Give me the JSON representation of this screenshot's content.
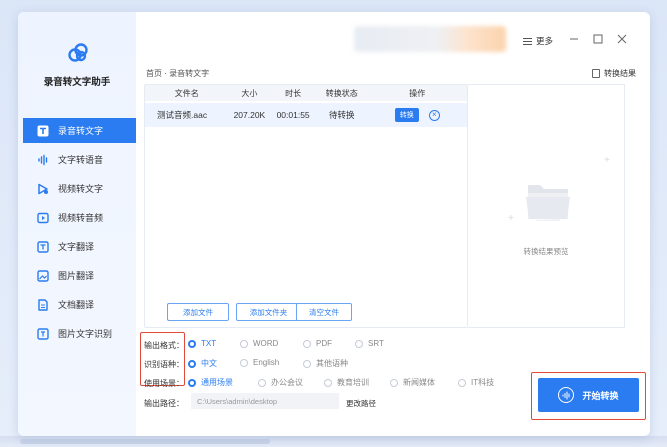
{
  "app": {
    "title": "录音转文字助手"
  },
  "colors": {
    "accent": "#2a7cf0",
    "highlight_box": "#e04a3a"
  },
  "sidebar": {
    "items": [
      {
        "label": "录音转文字",
        "icon": "text-t-icon",
        "active": true
      },
      {
        "label": "文字转语音",
        "icon": "audio-wave-icon",
        "active": false
      },
      {
        "label": "视频转文字",
        "icon": "video-play-icon",
        "active": false
      },
      {
        "label": "视频转音频",
        "icon": "video-audio-icon",
        "active": false
      },
      {
        "label": "文字翻译",
        "icon": "translate-icon",
        "active": false
      },
      {
        "label": "图片翻译",
        "icon": "image-translate-icon",
        "active": false
      },
      {
        "label": "文档翻译",
        "icon": "document-translate-icon",
        "active": false
      },
      {
        "label": "图片文字识别",
        "icon": "ocr-icon",
        "active": false
      }
    ]
  },
  "topbar": {
    "more_label": "更多"
  },
  "breadcrumb": "首页 · 录音转文字",
  "result_link": "转换结果",
  "table": {
    "headers": [
      "文件名",
      "大小",
      "时长",
      "转换状态",
      "操作"
    ],
    "rows": [
      {
        "name": "测试音频.aac",
        "size": "207.20K",
        "duration": "00:01:55",
        "status": "待转换",
        "action": "转换"
      }
    ]
  },
  "buttons": {
    "add_file": "添加文件",
    "add_folder": "添加文件夹",
    "clear_files": "清空文件",
    "start": "开始转换"
  },
  "preview": {
    "label": "转换结果预览"
  },
  "settings": {
    "output_format_label": "输出格式：",
    "output_formats": [
      "TXT",
      "WORD",
      "PDF",
      "SRT"
    ],
    "output_format_selected": "TXT",
    "language_label": "识别语种：",
    "languages": [
      "中文",
      "English",
      "其他语种"
    ],
    "language_selected": "中文",
    "scene_label": "使用场景：",
    "scenes": [
      "通用场景",
      "办公会议",
      "教育培训",
      "新闻媒体",
      "IT科技"
    ],
    "scene_selected": "通用场景",
    "path_label": "输出路径：",
    "path_value": "C:\\Users\\admin\\desktop",
    "change_path": "更改路径"
  }
}
